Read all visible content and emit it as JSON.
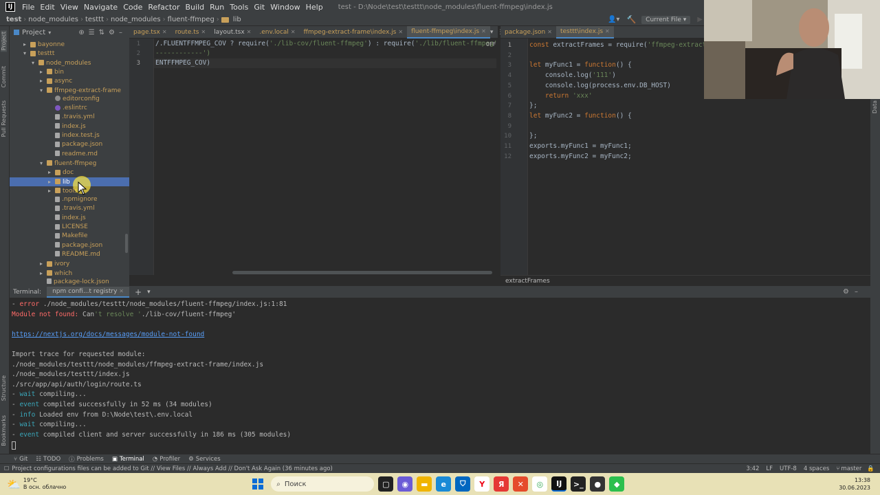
{
  "menubar": {
    "logo": "IJ",
    "items": [
      "File",
      "Edit",
      "View",
      "Navigate",
      "Code",
      "Refactor",
      "Build",
      "Run",
      "Tools",
      "Git",
      "Window",
      "Help"
    ],
    "window_title": "test - D:\\Node\\test\\testtt\\node_modules\\fluent-ffmpeg\\index.js"
  },
  "breadcrumb": [
    "test",
    "node_modules",
    "testtt",
    "node_modules",
    "fluent-ffmpeg",
    "lib"
  ],
  "run_config": "Current File",
  "project_header": "Project",
  "left_strip": [
    "Project",
    "Commit",
    "Pull Requests",
    "Structure",
    "Bookmarks"
  ],
  "tree": [
    {
      "label": "bayonne",
      "indent": 2,
      "arrow": "▸",
      "type": "folder",
      "color": "#c8a05a"
    },
    {
      "label": "testtt",
      "indent": 2,
      "arrow": "▾",
      "type": "folder",
      "color": "#c8a05a"
    },
    {
      "label": "node_modules",
      "indent": 3,
      "arrow": "▾",
      "type": "folder",
      "color": "#c8a05a"
    },
    {
      "label": "bin",
      "indent": 4,
      "arrow": "▸",
      "type": "folder",
      "color": "#c8a05a"
    },
    {
      "label": "async",
      "indent": 4,
      "arrow": "▸",
      "type": "folder",
      "color": "#c8a05a"
    },
    {
      "label": "ffmpeg-extract-frame",
      "indent": 4,
      "arrow": "▾",
      "type": "folder",
      "color": "#c8a05a"
    },
    {
      "label": "editorconfig",
      "indent": 5,
      "arrow": "",
      "type": "gear",
      "color": "#c8a05a"
    },
    {
      "label": ".eslintrc",
      "indent": 5,
      "arrow": "",
      "type": "circle",
      "color": "#c8a05a"
    },
    {
      "label": ".travis.yml",
      "indent": 5,
      "arrow": "",
      "type": "file",
      "color": "#c8a05a"
    },
    {
      "label": "index.js",
      "indent": 5,
      "arrow": "",
      "type": "file",
      "color": "#c8a05a"
    },
    {
      "label": "index.test.js",
      "indent": 5,
      "arrow": "",
      "type": "file",
      "color": "#c8a05a"
    },
    {
      "label": "package.json",
      "indent": 5,
      "arrow": "",
      "type": "file",
      "color": "#c8a05a"
    },
    {
      "label": "readme.md",
      "indent": 5,
      "arrow": "",
      "type": "file",
      "color": "#c8a05a"
    },
    {
      "label": "fluent-ffmpeg",
      "indent": 4,
      "arrow": "▾",
      "type": "folder",
      "color": "#c8a05a"
    },
    {
      "label": "doc",
      "indent": 5,
      "arrow": "▸",
      "type": "folder",
      "color": "#c8a05a"
    },
    {
      "label": "lib",
      "indent": 5,
      "arrow": "▸",
      "type": "folder",
      "color": "#c8a05a",
      "selected": true
    },
    {
      "label": "tools",
      "indent": 5,
      "arrow": "▸",
      "type": "folder",
      "color": "#c8a05a"
    },
    {
      "label": ".npmignore",
      "indent": 5,
      "arrow": "",
      "type": "file",
      "color": "#c8a05a"
    },
    {
      "label": ".travis.yml",
      "indent": 5,
      "arrow": "",
      "type": "file",
      "color": "#c8a05a"
    },
    {
      "label": "index.js",
      "indent": 5,
      "arrow": "",
      "type": "file",
      "color": "#c8a05a"
    },
    {
      "label": "LICENSE",
      "indent": 5,
      "arrow": "",
      "type": "file",
      "color": "#c8a05a"
    },
    {
      "label": "Makefile",
      "indent": 5,
      "arrow": "",
      "type": "file",
      "color": "#c8a05a"
    },
    {
      "label": "package.json",
      "indent": 5,
      "arrow": "",
      "type": "file",
      "color": "#c8a05a"
    },
    {
      "label": "README.md",
      "indent": 5,
      "arrow": "",
      "type": "file",
      "color": "#c8a05a"
    },
    {
      "label": "ivory",
      "indent": 4,
      "arrow": "▸",
      "type": "folder",
      "color": "#c8a05a"
    },
    {
      "label": "which",
      "indent": 4,
      "arrow": "▸",
      "type": "folder",
      "color": "#c8a05a"
    },
    {
      "label": "package-lock.json",
      "indent": 4,
      "arrow": "",
      "type": "file",
      "color": "#c8a05a"
    }
  ],
  "tabs_left": [
    {
      "label": "page.tsx",
      "active": false
    },
    {
      "label": "route.ts",
      "active": false
    },
    {
      "label": "layout.tsx",
      "active": false
    },
    {
      "label": ".env.local",
      "active": false
    },
    {
      "label": "ffmpeg-extract-frame\\index.js",
      "active": false
    },
    {
      "label": "fluent-ffmpeg\\index.js",
      "active": true
    }
  ],
  "tabs_right": [
    {
      "label": "package.json",
      "active": false
    },
    {
      "label": "testtt\\index.js",
      "active": true
    }
  ],
  "editor_left": {
    "lines": [
      {
        "n": "1",
        "text": "/.FLUENTFFMPEG_COV ? require('./lib-cov/fluent-ffmpeg') : require('./lib/fluent-ffmpeg');"
      },
      {
        "n": "2",
        "text": "------------')"
      },
      {
        "n": "3",
        "text": "ENTFFMPEG_COV)"
      }
    ],
    "badge": "OFF"
  },
  "editor_right": {
    "lines": [
      {
        "n": "1",
        "text": "const extractFrames = require('ffmpeg-extract-frame')"
      },
      {
        "n": "2",
        "text": ""
      },
      {
        "n": "3",
        "text": "let myFunc1 = function() {"
      },
      {
        "n": "4",
        "text": "    console.log('111')"
      },
      {
        "n": "5",
        "text": "    console.log(process.env.DB_HOST)"
      },
      {
        "n": "6",
        "text": "    return 'xxx'"
      },
      {
        "n": "7",
        "text": "};"
      },
      {
        "n": "8",
        "text": "let myFunc2 = function() {"
      },
      {
        "n": "9",
        "text": ""
      },
      {
        "n": "10",
        "text": "};"
      },
      {
        "n": "11",
        "text": "exports.myFunc1 = myFunc1;"
      },
      {
        "n": "12",
        "text": "exports.myFunc2 = myFunc2;"
      }
    ],
    "breadcrumb": "extractFrames"
  },
  "terminal": {
    "label": "Terminal:",
    "tab": "npm confi...t registry",
    "lines": [
      {
        "text": "- error ./node_modules/testtt/node_modules/fluent-ffmpeg/index.js:1:81",
        "kind": "error"
      },
      {
        "text": "Module not found: Can't resolve './lib-cov/fluent-ffmpeg'",
        "kind": "notfound"
      },
      {
        "text": "",
        "kind": "plain"
      },
      {
        "text": "https://nextjs.org/docs/messages/module-not-found",
        "kind": "link"
      },
      {
        "text": "",
        "kind": "plain"
      },
      {
        "text": "Import trace for requested module:",
        "kind": "plain"
      },
      {
        "text": "./node_modules/testtt/node_modules/ffmpeg-extract-frame/index.js",
        "kind": "plain"
      },
      {
        "text": "./node_modules/testtt/index.js",
        "kind": "plain"
      },
      {
        "text": "./src/app/api/auth/login/route.ts",
        "kind": "plain"
      },
      {
        "text": "- wait compiling...",
        "kind": "wait"
      },
      {
        "text": "- event compiled successfully in 52 ms (34 modules)",
        "kind": "event"
      },
      {
        "text": "- info Loaded env from D:\\Node\\test\\.env.local",
        "kind": "info"
      },
      {
        "text": "- wait compiling...",
        "kind": "wait"
      },
      {
        "text": "- event compiled client and server successfully in 186 ms (305 modules)",
        "kind": "event"
      }
    ]
  },
  "bottom_tabs": [
    "Git",
    "TODO",
    "Problems",
    "Terminal",
    "Profiler",
    "Services"
  ],
  "status": {
    "message": "Project configurations files can be added to Git // View Files // Always Add // Don't Ask Again (36 minutes ago)",
    "position": "3:42",
    "line_sep": "LF",
    "encoding": "UTF-8",
    "indent": "4 spaces",
    "branch": "master"
  },
  "taskbar": {
    "temp": "19°C",
    "weather": "В осн. облачно",
    "search": "Поиск",
    "time": "13:38",
    "date": "30.06.2023"
  },
  "colors": {
    "keyword": "#cc7832",
    "string": "#6a8759",
    "error": "#ff6b68",
    "link": "#589df6",
    "wait": "#3aa6b9",
    "selected": "#4b6eaf"
  }
}
